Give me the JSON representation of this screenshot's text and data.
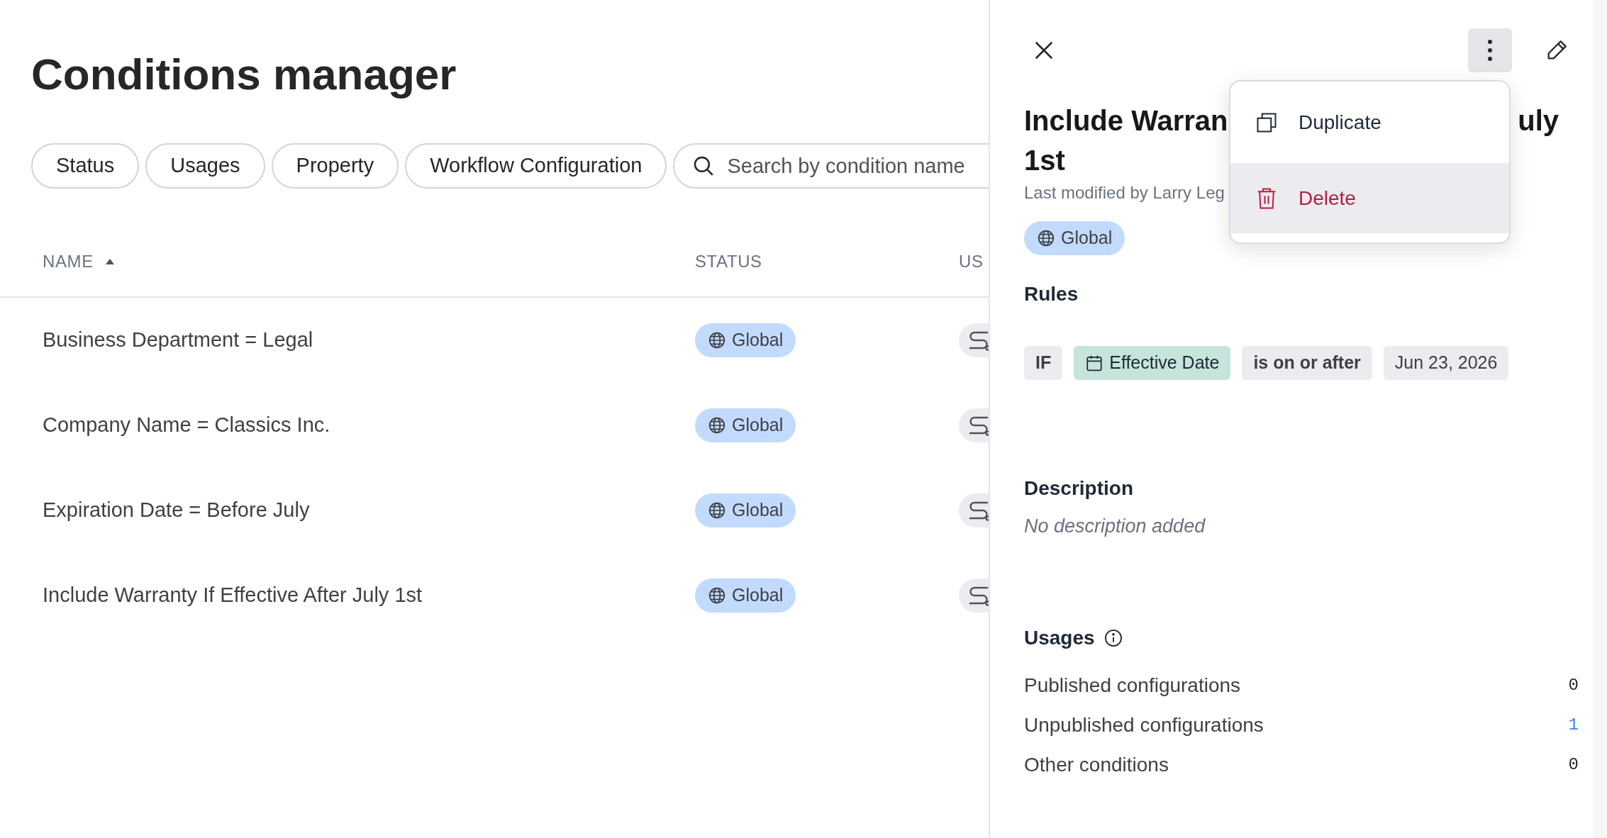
{
  "page": {
    "title": "Conditions manager"
  },
  "filters": [
    {
      "label": "Status"
    },
    {
      "label": "Usages"
    },
    {
      "label": "Property"
    },
    {
      "label": "Workflow Configuration"
    }
  ],
  "search": {
    "placeholder": "Search by condition name"
  },
  "table": {
    "columns": [
      {
        "label": "NAME",
        "sorted_ascending": true
      },
      {
        "label": "STATUS",
        "sorted_ascending": false
      },
      {
        "label": "US",
        "sorted_ascending": false
      }
    ],
    "rows": [
      {
        "name": "Business Department = Legal",
        "status": "Global"
      },
      {
        "name": "Company Name = Classics Inc.",
        "status": "Global"
      },
      {
        "name": "Expiration Date = Before July",
        "status": "Global"
      },
      {
        "name": "Include Warranty If Effective After July 1st",
        "status": "Global"
      }
    ]
  },
  "panel": {
    "more_button_active": true,
    "title": {
      "line_1_start": "Include Warran",
      "line_1_end": "uly",
      "line_2": "1st"
    },
    "modified": "Last modified by Larry Leg",
    "status": "Global",
    "rules_heading": "Rules",
    "rule": [
      {
        "kind": "keyword",
        "text": "IF"
      },
      {
        "kind": "field",
        "text": "Effective Date"
      },
      {
        "kind": "operator",
        "text": "is on or after"
      },
      {
        "kind": "value",
        "text": "Jun 23, 2026"
      }
    ],
    "description_heading": "Description",
    "description": "No description added",
    "usages_heading": "Usages",
    "usages": [
      {
        "label": "Published configurations",
        "count": "0",
        "linked": false
      },
      {
        "label": "Unpublished configurations",
        "count": "1",
        "linked": true
      },
      {
        "label": "Other conditions",
        "count": "0",
        "linked": false
      }
    ]
  },
  "menu": [
    {
      "kind": "duplicate",
      "label": "Duplicate",
      "hovered": false
    },
    {
      "kind": "delete",
      "label": "Delete",
      "hovered": true
    }
  ]
}
